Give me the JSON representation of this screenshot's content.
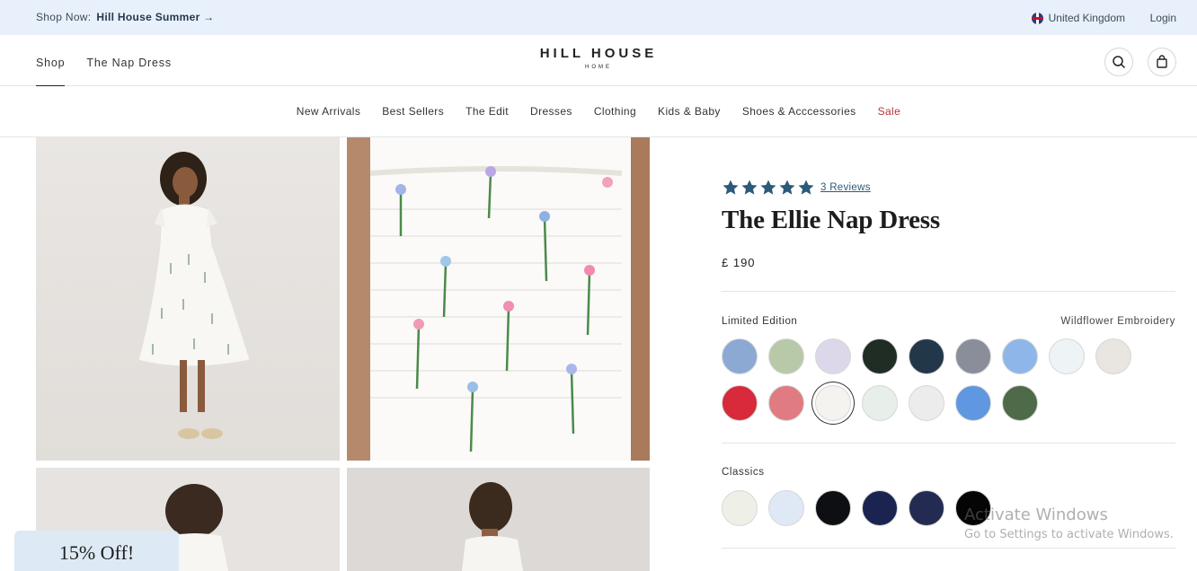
{
  "announcement": {
    "prefix": "Shop Now:",
    "link": "Hill House Summer →",
    "region": "United Kingdom",
    "login": "Login"
  },
  "header": {
    "nav": [
      {
        "label": "Shop"
      },
      {
        "label": "The Nap Dress"
      }
    ],
    "logo": {
      "main": "HILL HOUSE",
      "sub": "HOME"
    }
  },
  "categories": [
    {
      "label": "New Arrivals"
    },
    {
      "label": "Best Sellers"
    },
    {
      "label": "The Edit"
    },
    {
      "label": "Dresses"
    },
    {
      "label": "Clothing"
    },
    {
      "label": "Kids & Baby"
    },
    {
      "label": "Shoes & Acccessories"
    },
    {
      "label": "Sale"
    }
  ],
  "product": {
    "rating": 5,
    "reviews": "3 Reviews",
    "title": "The Ellie Nap Dress",
    "price": "£ 190",
    "sections": [
      {
        "label": "Limited Edition",
        "selected": "Wildflower Embroidery"
      },
      {
        "label": "Classics"
      }
    ]
  },
  "colors": {
    "accent": "#2b5b78",
    "sale": "#b3363a",
    "limited": [
      "#8ca9d4",
      "#b7c9a8",
      "#dcd8ea",
      "#1f2d25",
      "#22384a",
      "#8a8e9a",
      "#8fb6e8",
      "#eef3f6",
      "#e9e6e2",
      "#d82a3a",
      "#e07b82",
      "#f5f3ef",
      "#e6efe9",
      "#ececec",
      "#5f97e0",
      "#4e6a48"
    ],
    "classics": [
      "#eef0e8",
      "#dfe9f6",
      "#0e0f12",
      "#1b2451",
      "#232b52",
      "#050505"
    ]
  },
  "promo_tab": "15% Off!",
  "os_watermark": {
    "line1": "Activate Windows",
    "line2": "Go to Settings to activate Windows."
  }
}
